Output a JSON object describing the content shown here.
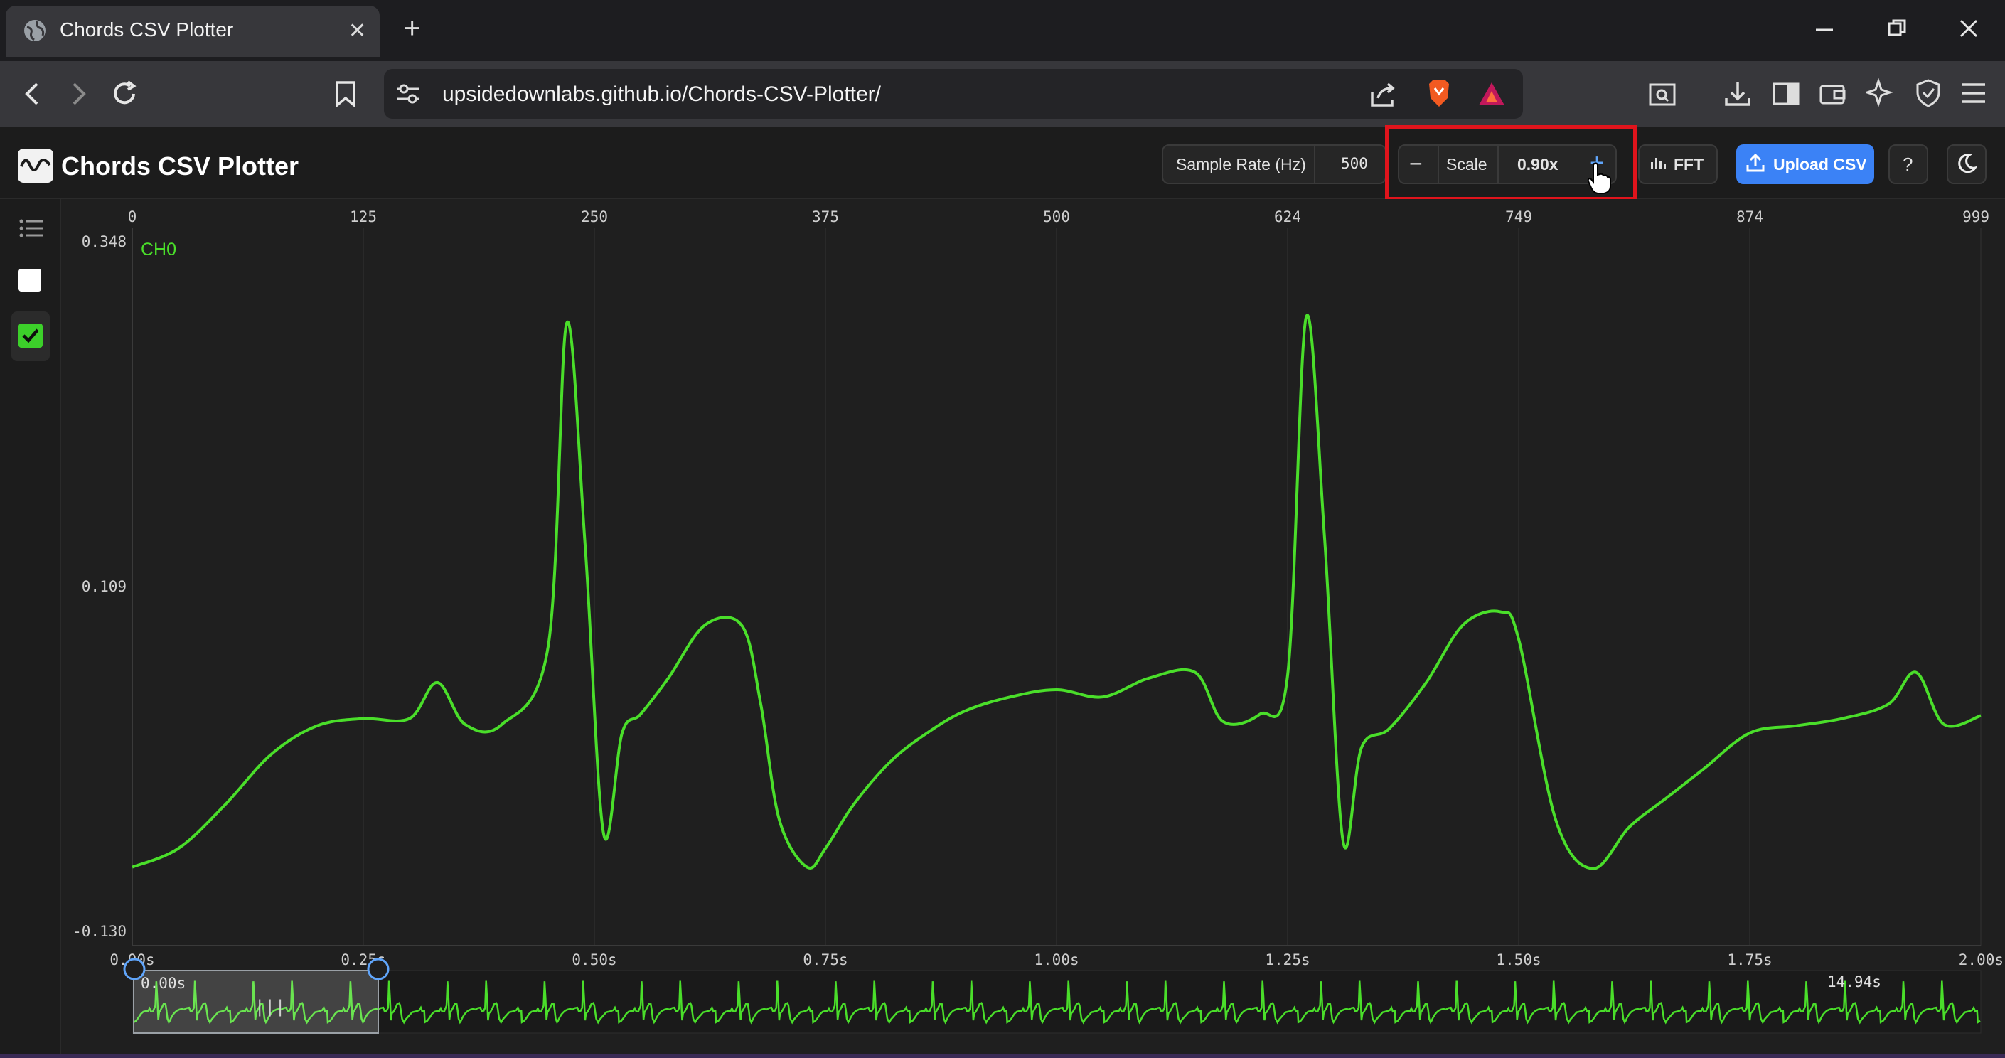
{
  "browser": {
    "tab_title": "Chords CSV Plotter",
    "url": "upsidedownlabs.github.io/Chords-CSV-Plotter/"
  },
  "app": {
    "title": "Chords CSV Plotter",
    "sample_rate_label": "Sample Rate (Hz)",
    "sample_rate_value": "500",
    "scale_label": "Scale",
    "scale_value": "0.90x",
    "scale_minus": "−",
    "scale_plus": "+",
    "fft_label": "FFT",
    "upload_label": "Upload CSV",
    "help_label": "?",
    "channel_toggles": [
      {
        "label": "",
        "checked": false
      },
      {
        "label": "",
        "checked": true
      }
    ]
  },
  "chart_data": {
    "type": "line",
    "series": [
      {
        "name": "CH0",
        "color": "#4ade2a"
      }
    ],
    "top_ticks": [
      "0",
      "125",
      "250",
      "375",
      "500",
      "624",
      "749",
      "874",
      "999"
    ],
    "yticks": [
      "0.348",
      "0.109",
      "-0.130"
    ],
    "ylim": [
      -0.13,
      0.348
    ],
    "xlim_seconds": [
      0.0,
      2.0
    ],
    "bottom_ticks": [
      "0.00s",
      "0.25s",
      "0.50s",
      "0.75s",
      "1.00s",
      "1.25s",
      "1.50s",
      "1.75s",
      "2.00s"
    ],
    "x": [
      0.0,
      0.05,
      0.1,
      0.15,
      0.2,
      0.25,
      0.3,
      0.33,
      0.36,
      0.4,
      0.45,
      0.47,
      0.49,
      0.51,
      0.53,
      0.55,
      0.58,
      0.62,
      0.66,
      0.68,
      0.7,
      0.73,
      0.75,
      0.78,
      0.82,
      0.86,
      0.9,
      0.95,
      1.0,
      1.05,
      1.1,
      1.15,
      1.18,
      1.22,
      1.25,
      1.27,
      1.29,
      1.31,
      1.33,
      1.36,
      1.4,
      1.44,
      1.48,
      1.5,
      1.54,
      1.58,
      1.62,
      1.66,
      1.7,
      1.75,
      1.8,
      1.85,
      1.9,
      1.93,
      1.96,
      2.0
    ],
    "y": [
      -0.083,
      -0.07,
      -0.04,
      -0.005,
      0.015,
      0.02,
      0.02,
      0.045,
      0.016,
      0.016,
      0.07,
      0.294,
      0.14,
      -0.06,
      0.01,
      0.023,
      0.048,
      0.085,
      0.084,
      0.03,
      -0.05,
      -0.083,
      -0.07,
      -0.04,
      -0.01,
      0.01,
      0.025,
      0.035,
      0.04,
      0.035,
      0.048,
      0.052,
      0.018,
      0.023,
      0.05,
      0.298,
      0.145,
      -0.065,
      0.0,
      0.013,
      0.045,
      0.085,
      0.094,
      0.075,
      -0.05,
      -0.084,
      -0.055,
      -0.035,
      -0.015,
      0.01,
      0.015,
      0.02,
      0.03,
      0.052,
      0.016,
      0.022
    ],
    "overview": {
      "start_label": "0.00s",
      "end_label": "14.94s",
      "window_seconds": [
        0.0,
        2.0
      ]
    }
  }
}
